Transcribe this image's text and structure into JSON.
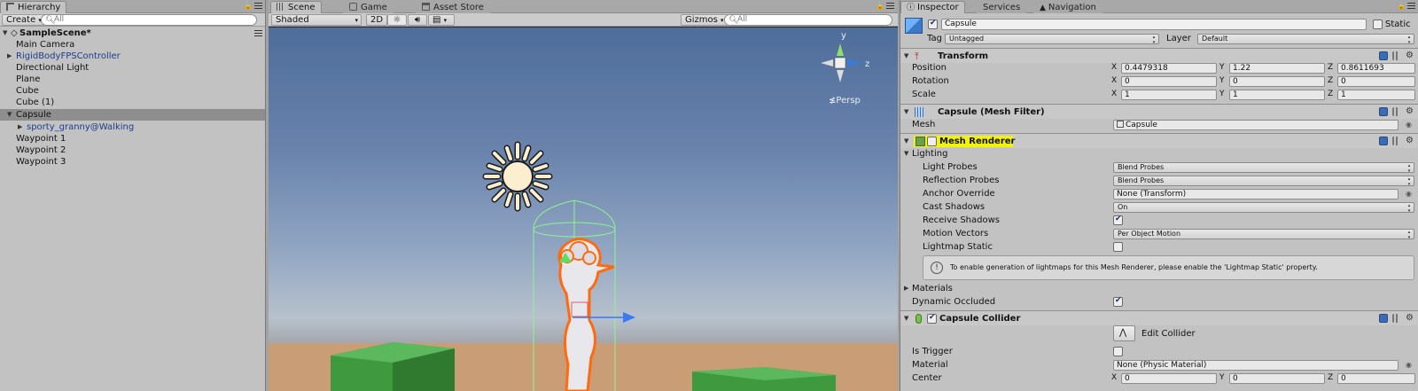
{
  "hierarchy": {
    "tab": "Hierarchy",
    "create": "Create",
    "search_placeholder": "All",
    "scene": "SampleScene*",
    "items": [
      {
        "label": "Main Camera"
      },
      {
        "label": "RigidBodyFPSController"
      },
      {
        "label": "Directional Light"
      },
      {
        "label": "Plane"
      },
      {
        "label": "Cube"
      },
      {
        "label": "Cube (1)"
      },
      {
        "label": "Capsule"
      },
      {
        "label": "sporty_granny@Walking"
      },
      {
        "label": "Waypoint 1"
      },
      {
        "label": "Waypoint 2"
      },
      {
        "label": "Waypoint 3"
      }
    ]
  },
  "scene": {
    "tabs": [
      "Scene",
      "Game",
      "Asset Store"
    ],
    "shading": "Shaded",
    "mode_2d": "2D",
    "gizmos": "Gizmos",
    "search_placeholder": "All",
    "persp": "Persp",
    "axis_y": "y",
    "axis_z": "z"
  },
  "inspector": {
    "tabs": [
      "Inspector",
      "Services",
      "Navigation"
    ],
    "object_name": "Capsule",
    "static_label": "Static",
    "tag_label": "Tag",
    "tag_value": "Untagged",
    "layer_label": "Layer",
    "layer_value": "Default",
    "transform": {
      "title": "Transform",
      "position_label": "Position",
      "rotation_label": "Rotation",
      "scale_label": "Scale",
      "axes": [
        "X",
        "Y",
        "Z"
      ],
      "position": [
        "0.4479318",
        "1.22",
        "0.8611693"
      ],
      "rotation": [
        "0",
        "0",
        "0"
      ],
      "scale": [
        "1",
        "1",
        "1"
      ]
    },
    "mesh_filter": {
      "title": "Capsule (Mesh Filter)",
      "mesh_label": "Mesh",
      "mesh_value": "Capsule"
    },
    "mesh_renderer": {
      "title": "Mesh Renderer",
      "lighting": "Lighting",
      "light_probes_label": "Light Probes",
      "light_probes_value": "Blend Probes",
      "reflection_probes_label": "Reflection Probes",
      "reflection_probes_value": "Blend Probes",
      "anchor_override_label": "Anchor Override",
      "anchor_override_value": "None (Transform)",
      "cast_shadows_label": "Cast Shadows",
      "cast_shadows_value": "On",
      "receive_shadows_label": "Receive Shadows",
      "motion_vectors_label": "Motion Vectors",
      "motion_vectors_value": "Per Object Motion",
      "lightmap_static_label": "Lightmap Static",
      "info": "To enable generation of lightmaps for this Mesh Renderer, please enable the 'Lightmap Static' property.",
      "materials_label": "Materials",
      "dynamic_occluded_label": "Dynamic Occluded"
    },
    "capsule_collider": {
      "title": "Capsule Collider",
      "edit_collider": "Edit Collider",
      "is_trigger_label": "Is Trigger",
      "material_label": "Material",
      "material_value": "None (Physic Material)",
      "center_label": "Center",
      "center": [
        "0",
        "0",
        "0"
      ]
    },
    "highlight_color": "#f2f20a"
  }
}
